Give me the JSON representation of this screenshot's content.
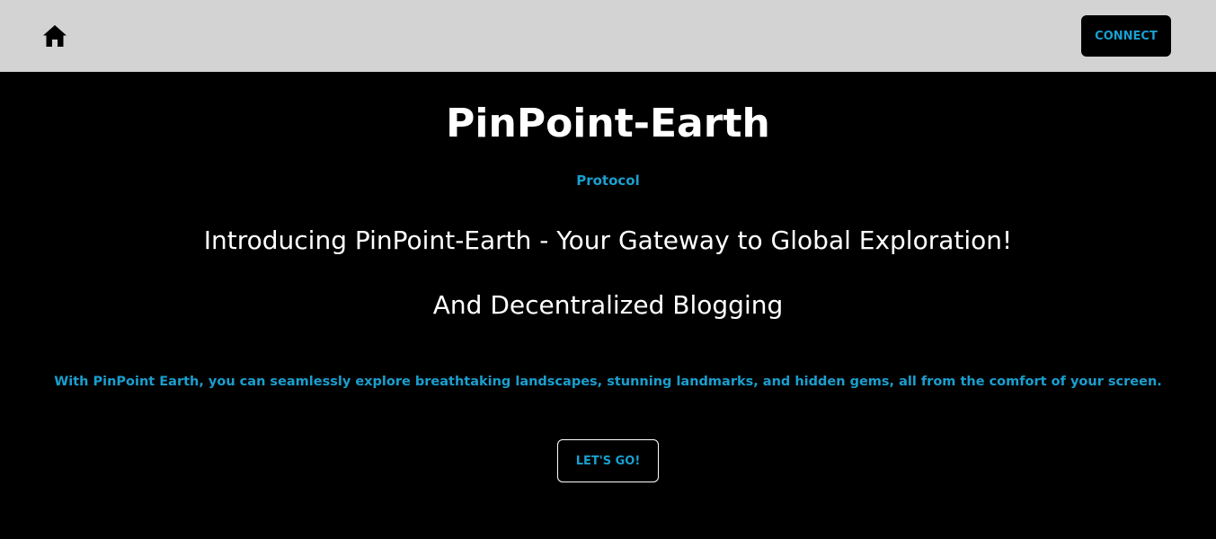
{
  "navbar": {
    "home_icon": "home-icon",
    "connect_label": "CONNECT"
  },
  "hero": {
    "title": "PinPoint-Earth",
    "subtitle": "Protocol",
    "headline": "Introducing PinPoint-Earth - Your Gateway to Global Exploration!",
    "headline2": "And Decentralized Blogging",
    "description": "With PinPoint Earth, you can seamlessly explore breathtaking landscapes, stunning landmarks, and hidden gems, all from the comfort of your screen.",
    "cta_label": "LET'S GO!"
  },
  "colors": {
    "navbar_bg": "#d3d3d3",
    "page_bg": "#000000",
    "accent": "#1a9fcf",
    "text": "#ffffff"
  }
}
